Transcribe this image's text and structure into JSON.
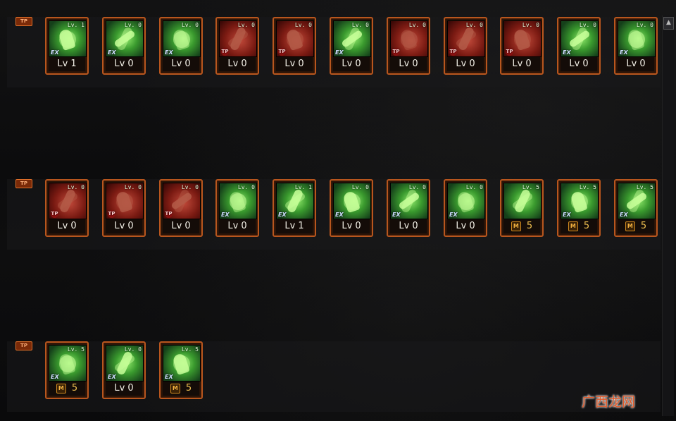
{
  "rows": [
    {
      "label": "TP",
      "skills": [
        {
          "icon": "ex-skill-icon",
          "type": "ex",
          "tier": "green",
          "level_tag": "Lv. 1",
          "caption": "Lv 1",
          "mastery": false
        },
        {
          "icon": "ex-skill-icon",
          "type": "ex",
          "tier": "green",
          "level_tag": "Lv. 0",
          "caption": "Lv 0",
          "mastery": false
        },
        {
          "icon": "ex-skill-icon",
          "type": "ex",
          "tier": "green",
          "level_tag": "Lv. 0",
          "caption": "Lv 0",
          "mastery": false
        },
        {
          "icon": "tp-skill-icon",
          "type": "tp",
          "tier": "red",
          "level_tag": "Lv. 0",
          "caption": "Lv 0",
          "mastery": false
        },
        {
          "icon": "tp-skill-icon",
          "type": "tp",
          "tier": "red",
          "level_tag": "Lv. 0",
          "caption": "Lv 0",
          "mastery": false
        },
        {
          "icon": "ex-skill-icon",
          "type": "ex",
          "tier": "green",
          "level_tag": "Lv. 0",
          "caption": "Lv 0",
          "mastery": false
        },
        {
          "icon": "tp-skill-icon",
          "type": "tp",
          "tier": "red",
          "level_tag": "Lv. 0",
          "caption": "Lv 0",
          "mastery": false
        },
        {
          "icon": "tp-skill-icon",
          "type": "tp",
          "tier": "red",
          "level_tag": "Lv. 0",
          "caption": "Lv 0",
          "mastery": false
        },
        {
          "icon": "tp-skill-icon",
          "type": "tp",
          "tier": "red",
          "level_tag": "Lv. 0",
          "caption": "Lv 0",
          "mastery": false
        },
        {
          "icon": "ex-skill-icon",
          "type": "ex",
          "tier": "green",
          "level_tag": "Lv. 0",
          "caption": "Lv 0",
          "mastery": false
        },
        {
          "icon": "ex-skill-icon",
          "type": "ex",
          "tier": "green",
          "level_tag": "Lv. 0",
          "caption": "Lv 0",
          "mastery": false
        }
      ]
    },
    {
      "label": "TP",
      "skills": [
        {
          "icon": "tp-skill-icon",
          "type": "tp",
          "tier": "red",
          "level_tag": "Lv. 0",
          "caption": "Lv 0",
          "mastery": false
        },
        {
          "icon": "tp-skill-icon",
          "type": "tp",
          "tier": "red",
          "level_tag": "Lv. 0",
          "caption": "Lv 0",
          "mastery": false
        },
        {
          "icon": "tp-skill-icon",
          "type": "tp",
          "tier": "red",
          "level_tag": "Lv. 0",
          "caption": "Lv 0",
          "mastery": false
        },
        {
          "icon": "ex-skill-icon",
          "type": "ex",
          "tier": "green",
          "level_tag": "Lv. 0",
          "caption": "Lv 0",
          "mastery": false
        },
        {
          "icon": "ex-skill-icon",
          "type": "ex",
          "tier": "green",
          "level_tag": "Lv. 1",
          "caption": "Lv 1",
          "mastery": false
        },
        {
          "icon": "ex-skill-icon",
          "type": "ex",
          "tier": "green",
          "level_tag": "Lv. 0",
          "caption": "Lv 0",
          "mastery": false
        },
        {
          "icon": "ex-skill-icon",
          "type": "ex",
          "tier": "green",
          "level_tag": "Lv. 0",
          "caption": "Lv 0",
          "mastery": false
        },
        {
          "icon": "ex-skill-icon",
          "type": "ex",
          "tier": "green",
          "level_tag": "Lv. 0",
          "caption": "Lv 0",
          "mastery": false
        },
        {
          "icon": "mastery-skill-icon",
          "type": "none",
          "tier": "green",
          "level_tag": "Lv. 5",
          "caption": "5",
          "mastery": true
        },
        {
          "icon": "ex-skill-icon",
          "type": "ex",
          "tier": "green",
          "level_tag": "Lv. 5",
          "caption": "5",
          "mastery": true
        },
        {
          "icon": "ex-skill-icon",
          "type": "ex",
          "tier": "green",
          "level_tag": "Lv. 5",
          "caption": "5",
          "mastery": true
        }
      ]
    },
    {
      "label": "TP",
      "skills": [
        {
          "icon": "ex-skill-icon",
          "type": "ex",
          "tier": "green",
          "level_tag": "Lv. 5",
          "caption": "5",
          "mastery": true
        },
        {
          "icon": "ex-skill-icon",
          "type": "ex",
          "tier": "green",
          "level_tag": "Lv. 0",
          "caption": "Lv 0",
          "mastery": false
        },
        {
          "icon": "ex-skill-icon",
          "type": "ex",
          "tier": "green",
          "level_tag": "Lv. 5",
          "caption": "5",
          "mastery": true
        }
      ]
    }
  ],
  "badges": {
    "ex": "EX",
    "tp": "TP",
    "mastery": "M"
  },
  "scroll_up_glyph": "▲",
  "watermark": "广西龙网",
  "colors": {
    "frame": "#b8561e",
    "ex_icon": "#3a9a2e",
    "tp_icon": "#7a1a12",
    "mastery": "#f0c050"
  }
}
